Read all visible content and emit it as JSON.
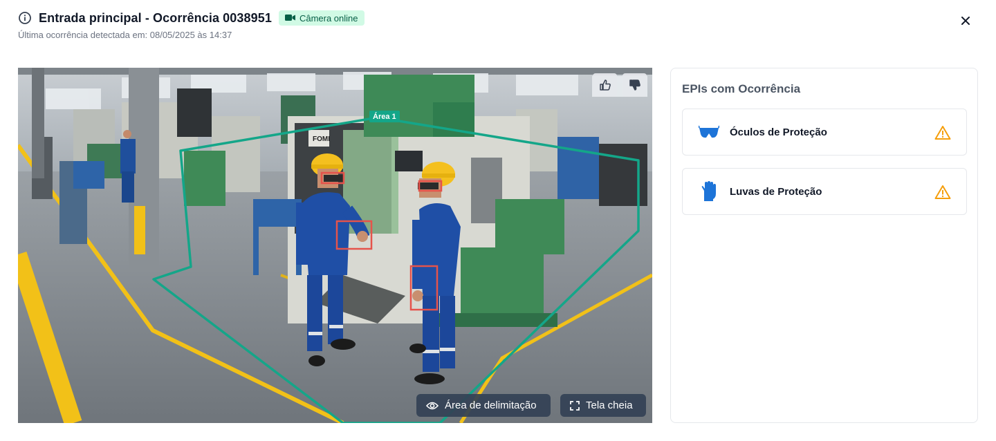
{
  "header": {
    "title": "Entrada principal - Ocorrência 0038951",
    "camera_status": "Câmera online",
    "subtitle": "Última ocorrência detectada em: 08/05/2025 às 14:37"
  },
  "viewer": {
    "area_label": "Área 1",
    "boundary_button": "Área de delimitação",
    "fullscreen_button": "Tela cheia"
  },
  "panel": {
    "title": "EPIs com Ocorrência",
    "items": [
      {
        "label": "Óculos de Proteção",
        "icon": "safety-glasses-icon"
      },
      {
        "label": "Luvas de Proteção",
        "icon": "gloves-icon"
      }
    ]
  },
  "colors": {
    "accent_zone": "#14a689",
    "detection_box": "#e5534b",
    "warning": "#f59e0b",
    "icon_blue": "#1d74d8",
    "badge_bg": "#d1fae5",
    "badge_text": "#065f46"
  }
}
